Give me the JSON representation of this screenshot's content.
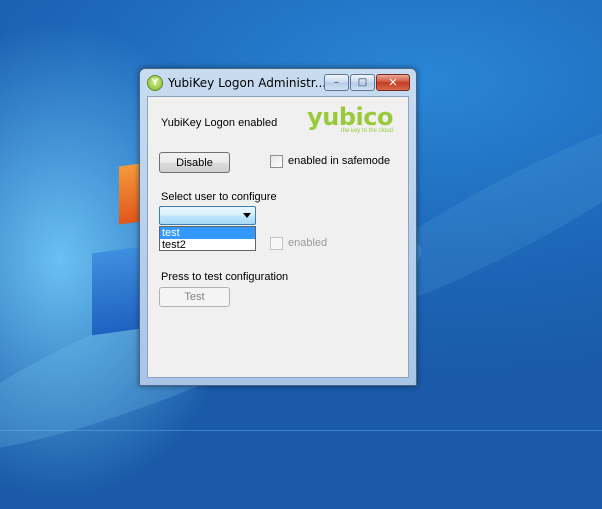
{
  "window": {
    "title": "YubiKey Logon Administr...",
    "icon": "yubikey-app-icon",
    "minimize_glyph": "–",
    "maximize_glyph": "□",
    "close_glyph": "✕"
  },
  "status": {
    "label": "YubiKey Logon enabled"
  },
  "logo": {
    "word": "yubico",
    "tagline": "the key to the cloud",
    "color": "#9aca3c"
  },
  "actions": {
    "disable_label": "Disable",
    "safemode_label": "enabled in safemode",
    "safemode_checked": false
  },
  "user_select": {
    "label": "Select user to configure",
    "selected_value": "",
    "options": [
      "test",
      "test2"
    ],
    "highlighted_option": "test"
  },
  "user_enabled": {
    "label": "enabled",
    "checked": false,
    "disabled": true
  },
  "test_section": {
    "label": "Press to test configuration",
    "button_label": "Test",
    "button_disabled": true
  }
}
